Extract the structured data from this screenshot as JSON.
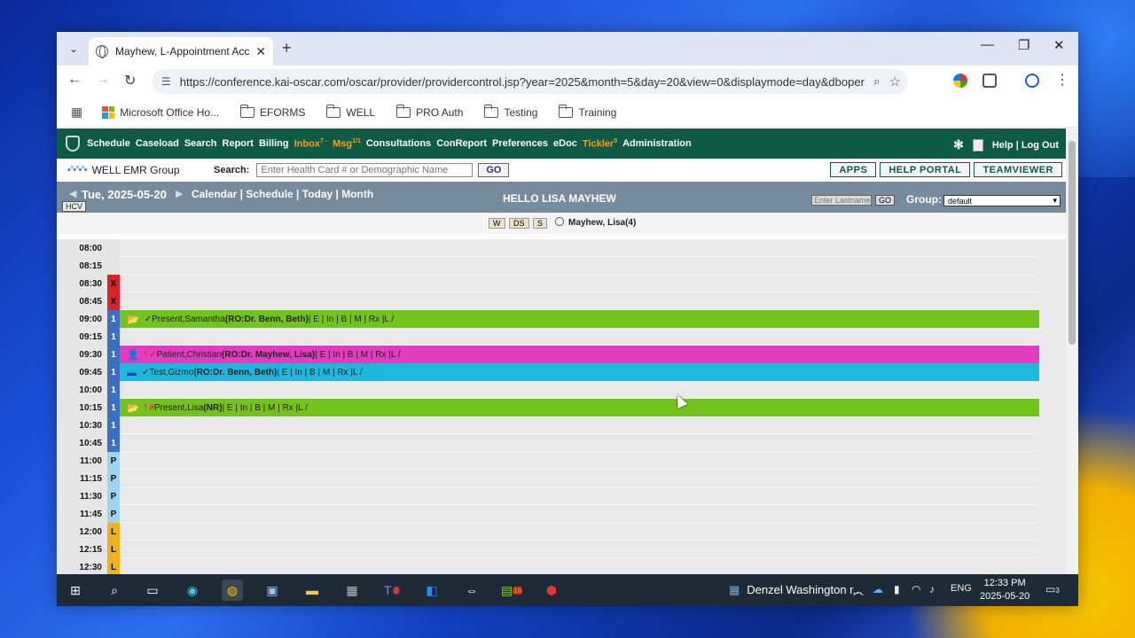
{
  "browser": {
    "tab_title": "Mayhew, L-Appointment Acces",
    "url": "https://conference.kai-oscar.com/oscar/provider/providercontrol.jsp?year=2025&month=5&day=20&view=0&displaymode=day&dbopera...",
    "bookmarks": [
      "Microsoft Office Ho...",
      "EFORMS",
      "WELL",
      "PRO Auth",
      "Testing",
      "Training"
    ]
  },
  "emr": {
    "nav": [
      {
        "label": "Schedule",
        "sup": ""
      },
      {
        "label": "Caseload",
        "sup": ""
      },
      {
        "label": "Search",
        "sup": ""
      },
      {
        "label": "Report",
        "sup": ""
      },
      {
        "label": "Billing",
        "sup": ""
      },
      {
        "label": "Inbox",
        "sup": "7 -",
        "orange": true
      },
      {
        "label": "Msg",
        "sup": "1/1",
        "orange": true
      },
      {
        "label": "Consultations",
        "sup": ""
      },
      {
        "label": "ConReport",
        "sup": ""
      },
      {
        "label": "Preferences",
        "sup": ""
      },
      {
        "label": "eDoc",
        "sup": ""
      },
      {
        "label": "Tickler",
        "sup": "0",
        "orange": true
      },
      {
        "label": "Administration",
        "sup": ""
      }
    ],
    "help_logout": "Help | Log Out",
    "brand": "WELL EMR Group",
    "search_label": "Search:",
    "search_placeholder": "Enter Health Card # or Demographic Name",
    "go_label": "GO",
    "right_buttons": [
      "APPS",
      "HELP PORTAL",
      "TEAMVIEWER"
    ],
    "date": "Tue, 2025-05-20",
    "views": "Calendar | Schedule | Today | Month",
    "hcv": "HCV",
    "greeting": "HELLO LISA MAYHEW",
    "lastname_placeholder": "Enter Lastname",
    "go_small": "GO",
    "group_label": "Group:",
    "group_value": "default",
    "view_buttons": [
      "W",
      "DS",
      "S"
    ],
    "provider": "Mayhew, Lisa(4)",
    "schedule": [
      {
        "time": "08:00",
        "code": "",
        "codeColor": "#e6e6e6",
        "codeText": "#111"
      },
      {
        "time": "08:15",
        "code": "",
        "codeColor": "#e6e6e6",
        "codeText": "#111"
      },
      {
        "time": "08:30",
        "code": "X",
        "codeColor": "#d8232a",
        "codeText": "#111"
      },
      {
        "time": "08:45",
        "code": "X",
        "codeColor": "#d8232a",
        "codeText": "#111"
      },
      {
        "time": "09:00",
        "code": "1",
        "codeColor": "#3a6fc2",
        "codeText": "#fff",
        "appt": {
          "color": "#72c31c",
          "icon": "folder",
          "prefix": "✓ ",
          "name": "Present,Samantha",
          "ro": "(RO: ",
          "doctor": "Dr. Benn, Beth)",
          "tail": " | E | In | B | M | Rx |L  /"
        }
      },
      {
        "time": "09:15",
        "code": "1",
        "codeColor": "#3a6fc2",
        "codeText": "#fff"
      },
      {
        "time": "09:30",
        "code": "1",
        "codeColor": "#3a6fc2",
        "codeText": "#fff",
        "appt": {
          "color": "#e23cbf",
          "icon": "person",
          "prefix": "! ✓ ",
          "name": "Patient,Christian",
          "ro": "(RO: ",
          "doctor": "Dr. Mayhew, Lisa)",
          "tail": " | E | In | B | M | Rx |L  /"
        }
      },
      {
        "time": "09:45",
        "code": "1",
        "codeColor": "#3a6fc2",
        "codeText": "#fff",
        "appt": {
          "color": "#1db8dc",
          "icon": "card",
          "prefix": "✓ ",
          "name": "Test,Gizmo",
          "ro": "(RO: ",
          "doctor": "Dr. Benn, Beth)",
          "tail": " | E | In | B | M | Rx |L  /"
        }
      },
      {
        "time": "10:00",
        "code": "1",
        "codeColor": "#3a6fc2",
        "codeText": "#fff"
      },
      {
        "time": "10:15",
        "code": "1",
        "codeColor": "#3a6fc2",
        "codeText": "#fff",
        "appt": {
          "color": "#72c31c",
          "icon": "folder",
          "prefix": "! # ",
          "name": "Present,Lisa",
          "ro": "",
          "doctor": "(NR)",
          "tail": " | E | In | B | M | Rx |L  /"
        }
      },
      {
        "time": "10:30",
        "code": "1",
        "codeColor": "#3a6fc2",
        "codeText": "#fff"
      },
      {
        "time": "10:45",
        "code": "1",
        "codeColor": "#3a6fc2",
        "codeText": "#fff"
      },
      {
        "time": "11:00",
        "code": "P",
        "codeColor": "#9ed4f0",
        "codeText": "#111"
      },
      {
        "time": "11:15",
        "code": "P",
        "codeColor": "#9ed4f0",
        "codeText": "#111"
      },
      {
        "time": "11:30",
        "code": "P",
        "codeColor": "#9ed4f0",
        "codeText": "#111"
      },
      {
        "time": "11:45",
        "code": "P",
        "codeColor": "#9ed4f0",
        "codeText": "#111"
      },
      {
        "time": "12:00",
        "code": "L",
        "codeColor": "#f0b21a",
        "codeText": "#111"
      },
      {
        "time": "12:15",
        "code": "L",
        "codeColor": "#f0b21a",
        "codeText": "#111"
      },
      {
        "time": "12:30",
        "code": "L",
        "codeColor": "#f0b21a",
        "codeText": "#111"
      }
    ]
  },
  "taskbar": {
    "news": "Denzel Washington r...",
    "lang": "ENG",
    "time": "12:33 PM",
    "date": "2025-05-20",
    "notif_count": "3",
    "teams_badge": "2",
    "cal_badge": "16"
  },
  "colors": {
    "nav_bg": "#0e5a44",
    "datebar_bg": "#778b9e"
  }
}
